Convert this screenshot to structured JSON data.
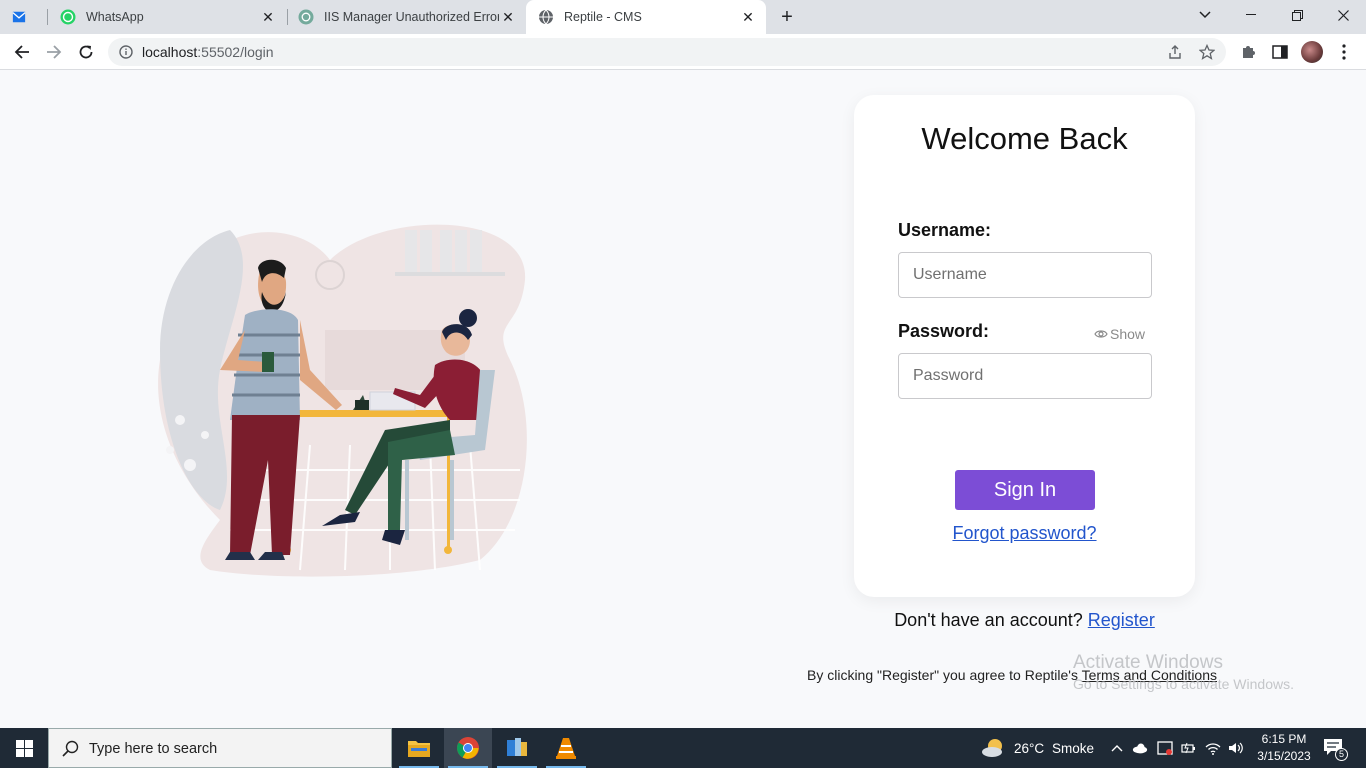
{
  "browser": {
    "tabs": [
      {
        "label": "WhatsApp"
      },
      {
        "label": "IIS Manager Unauthorized Error."
      },
      {
        "label": "Reptile - CMS"
      }
    ],
    "url_host": "localhost",
    "url_path": ":55502/login"
  },
  "login": {
    "title": "Welcome Back",
    "username_label": "Username:",
    "username_placeholder": "Username",
    "password_label": "Password:",
    "password_placeholder": "Password",
    "show_label": "Show",
    "signin_label": "Sign In",
    "forgot_label": "Forgot password?",
    "no_account_text": "Don't have an account?",
    "register_label": "Register",
    "terms_prefix": "By clicking \"Register\" you agree to Reptile's",
    "terms_link": "Terms and Conditions"
  },
  "watermark": {
    "line1": "Activate Windows",
    "line2": "Go to Settings to activate Windows."
  },
  "taskbar": {
    "search_placeholder": "Type here to search",
    "weather_temp": "26°C",
    "weather_desc": "Smoke",
    "time": "6:15 PM",
    "date": "3/15/2023",
    "notification_count": "5"
  },
  "colors": {
    "accent": "#7c4dd6",
    "link": "#2255cc",
    "taskbar": "#1f2a36"
  }
}
